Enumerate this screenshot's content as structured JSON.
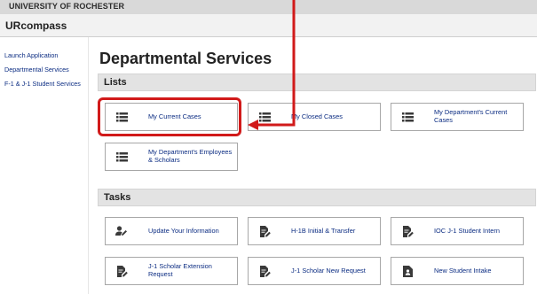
{
  "header": {
    "university": "UNIVERSITY OF ROCHESTER",
    "app_title": "URcompass"
  },
  "sidebar": {
    "items": [
      {
        "label": "Launch Application"
      },
      {
        "label": "Departmental Services"
      },
      {
        "label": "F-1 & J-1 Student Services"
      }
    ]
  },
  "main": {
    "title": "Departmental Services",
    "lists": {
      "header": "Lists",
      "tiles": [
        {
          "label": "My Current Cases",
          "icon": "list-icon"
        },
        {
          "label": "My Closed Cases",
          "icon": "list-icon"
        },
        {
          "label": "My Department's Current Cases",
          "icon": "list-icon"
        },
        {
          "label": "My Department's Employees & Scholars",
          "icon": "list-icon"
        }
      ]
    },
    "tasks": {
      "header": "Tasks",
      "tiles": [
        {
          "label": "Update Your Information",
          "icon": "user-edit-icon"
        },
        {
          "label": "H-1B Initial & Transfer",
          "icon": "document-edit-icon"
        },
        {
          "label": "IOC J-1 Student Intern",
          "icon": "document-edit-icon"
        },
        {
          "label": "J-1 Scholar Extension Request",
          "icon": "document-edit-icon"
        },
        {
          "label": "J-1 Scholar New Request",
          "icon": "document-edit-icon"
        },
        {
          "label": "New Student Intake",
          "icon": "id-card-icon"
        }
      ]
    }
  },
  "colors": {
    "accent": "#d11a1a",
    "link": "#0b2c82",
    "icon": "#3a3a3a",
    "section_bg": "#e3e3e3"
  }
}
